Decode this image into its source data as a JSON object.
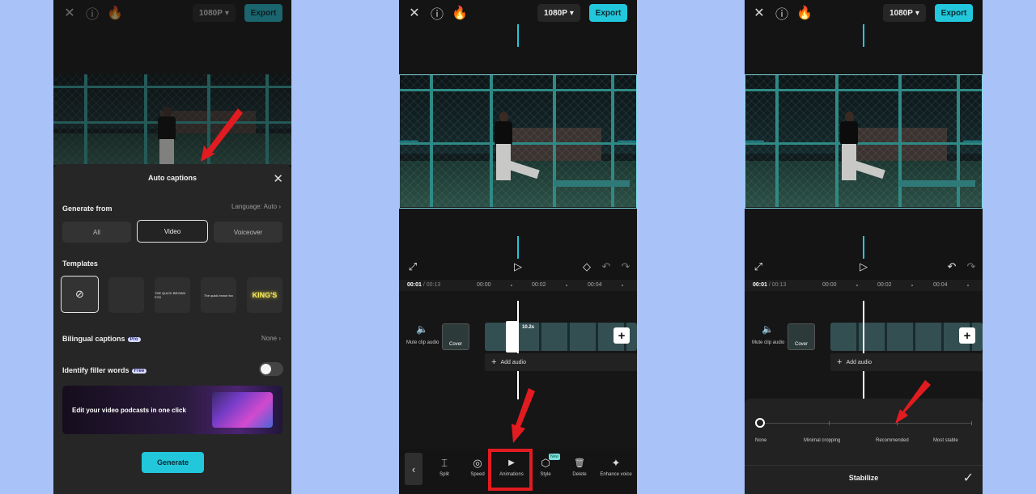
{
  "topbar": {
    "resolution": "1080P",
    "export_label": "Export"
  },
  "panel1": {
    "sheet_title": "Auto captions",
    "generate_from_label": "Generate from",
    "language_label": "Language: Auto",
    "segments": [
      "All",
      "Video",
      "Voiceover"
    ],
    "templates_label": "Templates",
    "templates": [
      "",
      "",
      "THE QUICK BROWN FOX",
      "The quick brown fox",
      "KING'S"
    ],
    "bilingual_label": "Bilingual captions",
    "pro_badge": "Pro",
    "bilingual_value": "None",
    "filler_label": "Identify filler words",
    "free_badge": "Free",
    "banner_text": "Edit your video podcasts in one click",
    "generate_label": "Generate"
  },
  "timeline": {
    "current_time": "00:01",
    "total_time": "/ 00:13",
    "ticks": [
      "00:00",
      "00:02",
      "00:04"
    ],
    "mute_label": "Mute clip audio",
    "cover_label": "Cover",
    "clip_duration": "10.2s",
    "add_audio_label": "Add audio"
  },
  "toolbar": {
    "tools": [
      {
        "icon": "⌶",
        "label": "Split"
      },
      {
        "icon": "◎",
        "label": "Speed"
      },
      {
        "icon": "▶",
        "label": "Animations"
      },
      {
        "icon": "⬡",
        "label": "Style"
      },
      {
        "icon": "🗑",
        "label": "Delete"
      },
      {
        "icon": "✦",
        "label": "Enhance voice"
      }
    ],
    "new_badge": "New"
  },
  "stabilize": {
    "options": [
      "None",
      "Minimal cropping",
      "Recommended",
      "Most stable"
    ],
    "title": "Stabilize"
  },
  "colors": {
    "accent": "#22c7dc",
    "highlight": "#e21b20",
    "background": "#a9c3f8"
  }
}
